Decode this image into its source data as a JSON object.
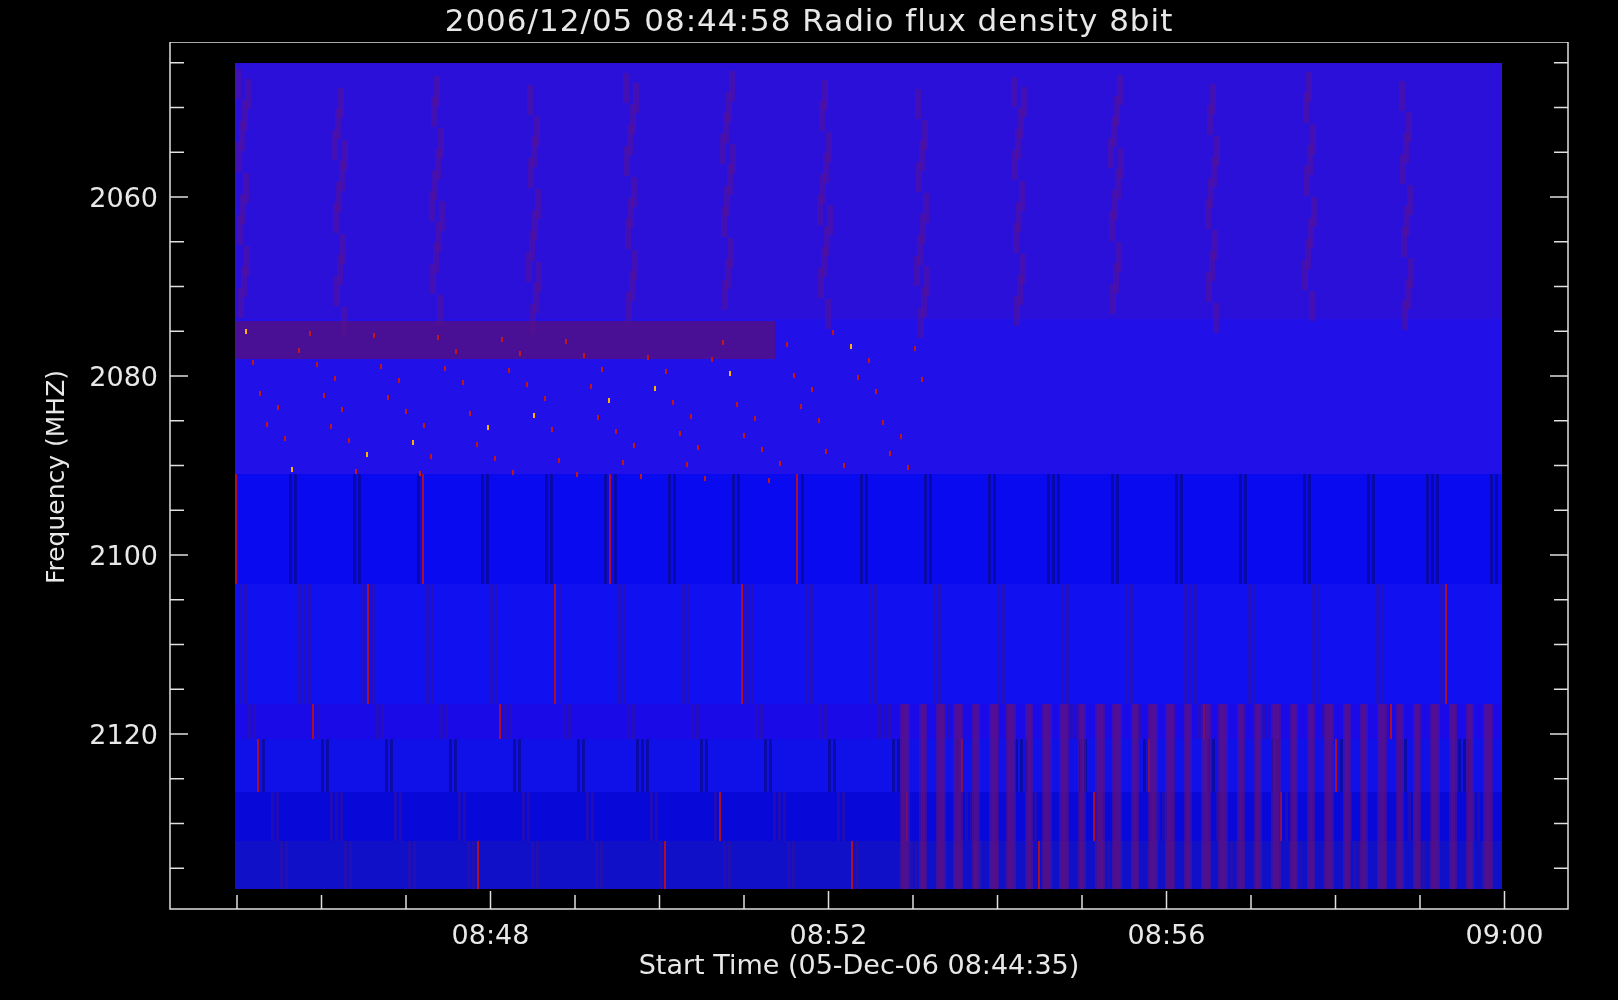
{
  "title": "2006/12/05 08:44:58 Radio flux density 8bit",
  "y_axis": {
    "title": "Frequency (MHZ)",
    "ticks": [
      "2060",
      "2080",
      "2100",
      "2120"
    ]
  },
  "x_axis": {
    "title": "Start Time (05-Dec-06 08:44:35)",
    "ticks": [
      "08:48",
      "08:52",
      "08:56",
      "09:00"
    ]
  }
}
